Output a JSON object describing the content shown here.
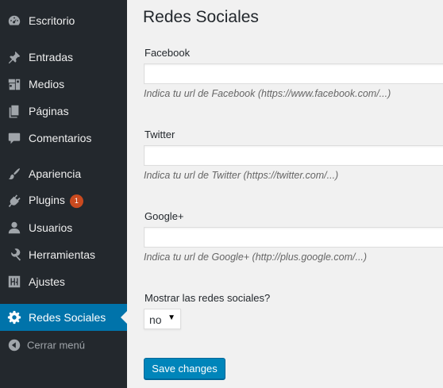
{
  "sidebar": {
    "items": [
      {
        "label": "Escritorio",
        "icon": "dashboard-icon"
      },
      {
        "label": "Entradas",
        "icon": "pin-icon"
      },
      {
        "label": "Medios",
        "icon": "media-icon"
      },
      {
        "label": "Páginas",
        "icon": "page-icon"
      },
      {
        "label": "Comentarios",
        "icon": "comment-icon"
      },
      {
        "label": "Apariencia",
        "icon": "brush-icon"
      },
      {
        "label": "Plugins",
        "icon": "plugin-icon",
        "badge": "1"
      },
      {
        "label": "Usuarios",
        "icon": "user-icon"
      },
      {
        "label": "Herramientas",
        "icon": "wrench-icon"
      },
      {
        "label": "Ajustes",
        "icon": "settings-sliders-icon"
      },
      {
        "label": "Redes Sociales",
        "icon": "gear-icon",
        "active": true
      }
    ],
    "collapse_label": "Cerrar menú"
  },
  "main": {
    "title": "Redes Sociales",
    "fields": [
      {
        "label": "Facebook",
        "value": "",
        "hint": "Indica tu url de Facebook (https://www.facebook.com/...)"
      },
      {
        "label": "Twitter",
        "value": "",
        "hint": "Indica tu url de Twitter (https://twitter.com/...)"
      },
      {
        "label": "Google+",
        "value": "",
        "hint": "Indica tu url de Google+ (http://plus.google.com/...)"
      }
    ],
    "show_label": "Mostrar las redes sociales?",
    "show_value": "no",
    "save_label": "Save changes"
  },
  "colors": {
    "sidebar_bg": "#23282d",
    "active_bg": "#0073aa",
    "badge_bg": "#ca4a1f",
    "button_bg": "#0085ba",
    "page_bg": "#f1f1f1"
  }
}
